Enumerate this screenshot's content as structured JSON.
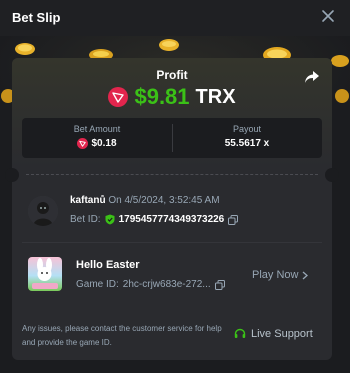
{
  "header": {
    "title": "Bet Slip",
    "close_icon": "close-icon"
  },
  "profit": {
    "label": "Profit",
    "value": "$9.81",
    "currency": "TRX",
    "value_color": "#3bc117",
    "share_icon": "share-icon"
  },
  "stats": {
    "bet_amount_label": "Bet Amount",
    "bet_amount_value": "$0.18",
    "payout_label": "Payout",
    "payout_value": "55.5617 x"
  },
  "user": {
    "name": "kaftanů",
    "on_date": "On 4/5/2024, 3:52:45 AM",
    "bet_id_label": "Bet ID:",
    "bet_id": "1795457774349373226"
  },
  "game": {
    "title": "Hello Easter",
    "id_label": "Game ID:",
    "id_value": "2hc-crjw683e-272...",
    "play_now": "Play Now"
  },
  "footer": {
    "help_text": "Any issues, please contact the customer service for help and provide the game ID.",
    "live_support": "Live Support",
    "live_support_icon_color": "#3bc117"
  },
  "colors": {
    "background": "#1b1c1f",
    "card": "#2a2b2f",
    "muted_text": "#98a7b5",
    "trx_red": "#e2254d"
  }
}
